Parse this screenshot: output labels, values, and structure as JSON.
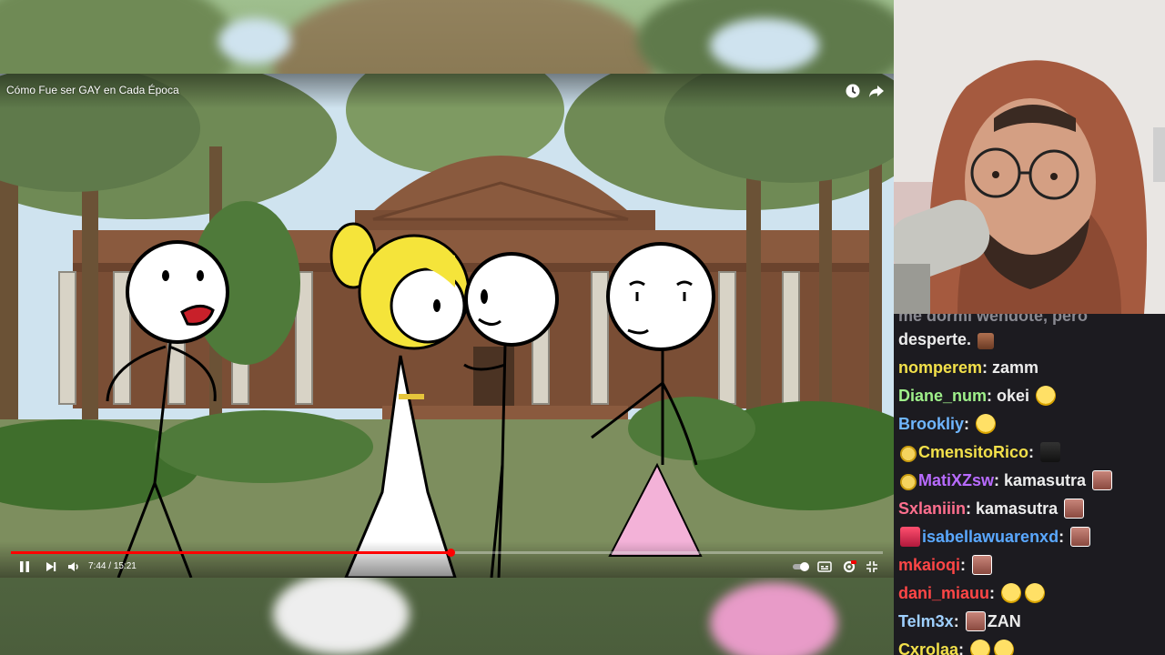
{
  "video": {
    "title": "Cómo Fue ser GAY en Cada Época",
    "current_time": "7:44",
    "duration": "15:21",
    "progress_percent": 50.4,
    "icons": [
      "watch-later-icon",
      "share-icon",
      "pause-icon",
      "next-icon",
      "volume-icon",
      "autoplay-toggle-icon",
      "captions-icon",
      "settings-icon",
      "miniplayer-icon"
    ]
  },
  "chat": {
    "messages": [
      {
        "user": "",
        "text": "me dormi wendote, pero",
        "user_color": "#8a8a92",
        "emotes_after": []
      },
      {
        "user": "",
        "text": "desperte.",
        "user_color": "#eeeeee",
        "emotes_after": [
          "small"
        ]
      },
      {
        "user": "nomperem",
        "text": "zamm",
        "user_color": "#f2e04a",
        "emotes_after": []
      },
      {
        "user": "Diane_num",
        "text": "okei",
        "user_color": "#9ff08a",
        "emotes_after": [
          "lol"
        ]
      },
      {
        "user": "Brookliy",
        "text": "",
        "user_color": "#6fb6ff",
        "emotes_after": [
          "lol"
        ]
      },
      {
        "user": "CmensitoRico",
        "text": "",
        "user_color": "#f2e04a",
        "badge": "sun",
        "emotes_after": [
          "dark"
        ]
      },
      {
        "user": "MatiXZsw",
        "text": "kamasutra",
        "user_color": "#b86bff",
        "badge": "sun",
        "emotes_after": [
          "face"
        ]
      },
      {
        "user": "Sxlaniiin",
        "text": "kamasutra",
        "user_color": "#ff6f8e",
        "emotes_after": [
          "face"
        ]
      },
      {
        "user": "isabellawuarenxd",
        "text": "",
        "user_color": "#5aa8ff",
        "badge": "rocket",
        "emotes_after": [
          "face"
        ]
      },
      {
        "user": "mkaioqi",
        "text": "",
        "user_color": "#ff4646",
        "emotes_after": [
          "face"
        ]
      },
      {
        "user": "dani_miauu",
        "text": "",
        "user_color": "#ff4646",
        "emotes_after": [
          "lol",
          "lol"
        ]
      },
      {
        "user": "Telm3x",
        "text": "ZAN",
        "user_color": "#9fd0ff",
        "emotes_before": [
          "face"
        ],
        "emotes_after": []
      },
      {
        "user": "Cxrolaa",
        "text": "",
        "user_color": "#f2e04a",
        "emotes_after": [
          "lol",
          "lol"
        ]
      }
    ]
  }
}
